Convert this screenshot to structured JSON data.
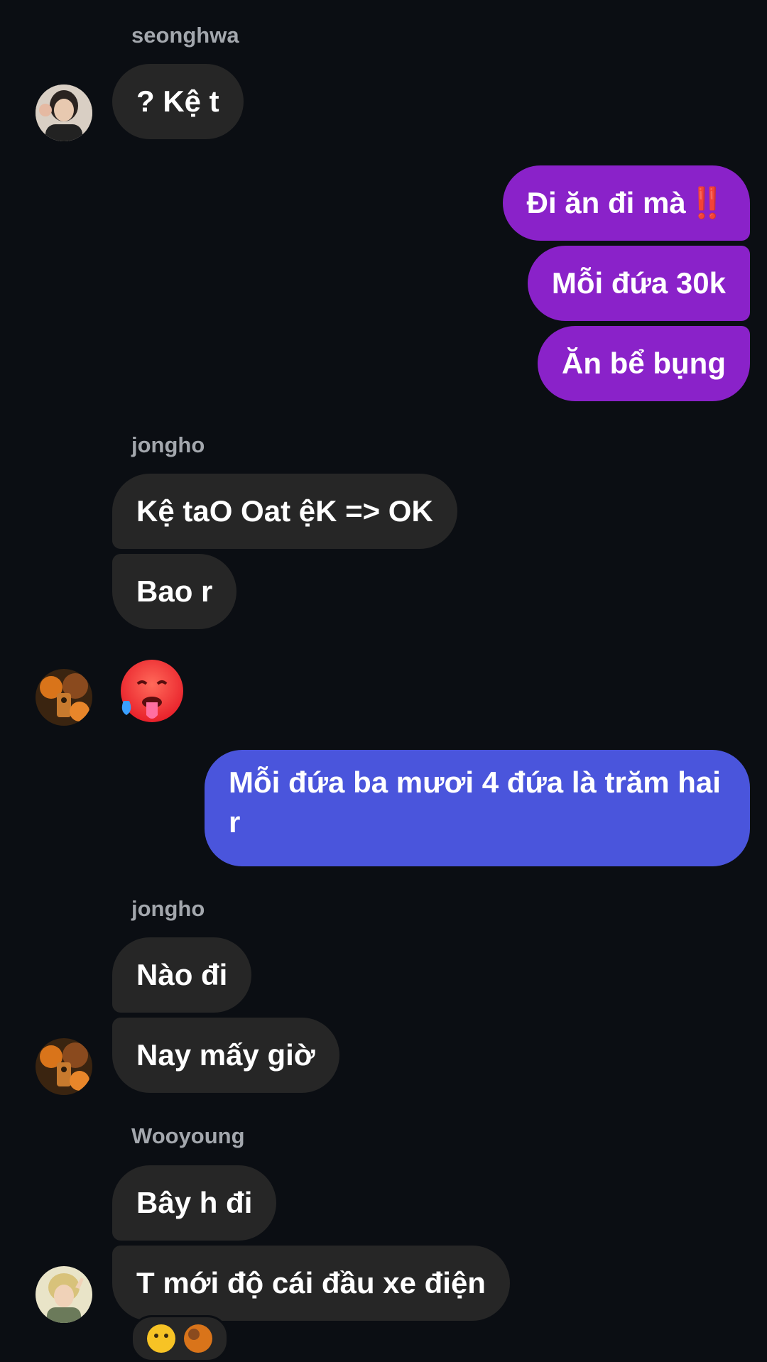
{
  "messages": {
    "m1": {
      "sender": "seonghwa",
      "text": "? Kệ t"
    },
    "m2": {
      "text": "Đi ăn đi mà",
      "emoji": "‼️"
    },
    "m3": {
      "text": "Mỗi đứa 30k"
    },
    "m4": {
      "text": "Ăn bể bụng"
    },
    "m5": {
      "sender": "jongho",
      "text": "Kệ taO Oat ệK => OK"
    },
    "m6": {
      "text": "Bao r"
    },
    "m7": {
      "emoji": "hot-face-emoji"
    },
    "m8": {
      "text_line1": "Mỗi đứa ba mươi 4 đứa là trăm hai",
      "text_line2": "r"
    },
    "m9": {
      "sender": "jongho",
      "text": "Nào đi"
    },
    "m10": {
      "text": "Nay mấy giờ"
    },
    "m11": {
      "sender": "Wooyoung",
      "text": "Bây h đi"
    },
    "m12": {
      "text": "T mới độ cái đầu xe điện"
    }
  },
  "colors": {
    "background": "#0b0e13",
    "incoming_bubble": "#262626",
    "outgoing_purple": "#8a22c9",
    "outgoing_blue": "#4a55dc",
    "sender_name": "#a3a7ad"
  },
  "icons": [
    "avatar-seonghwa",
    "avatar-jongho",
    "avatar-wooyoung",
    "double-exclamation-icon",
    "hot-face-emoji",
    "smile-reaction-icon"
  ]
}
